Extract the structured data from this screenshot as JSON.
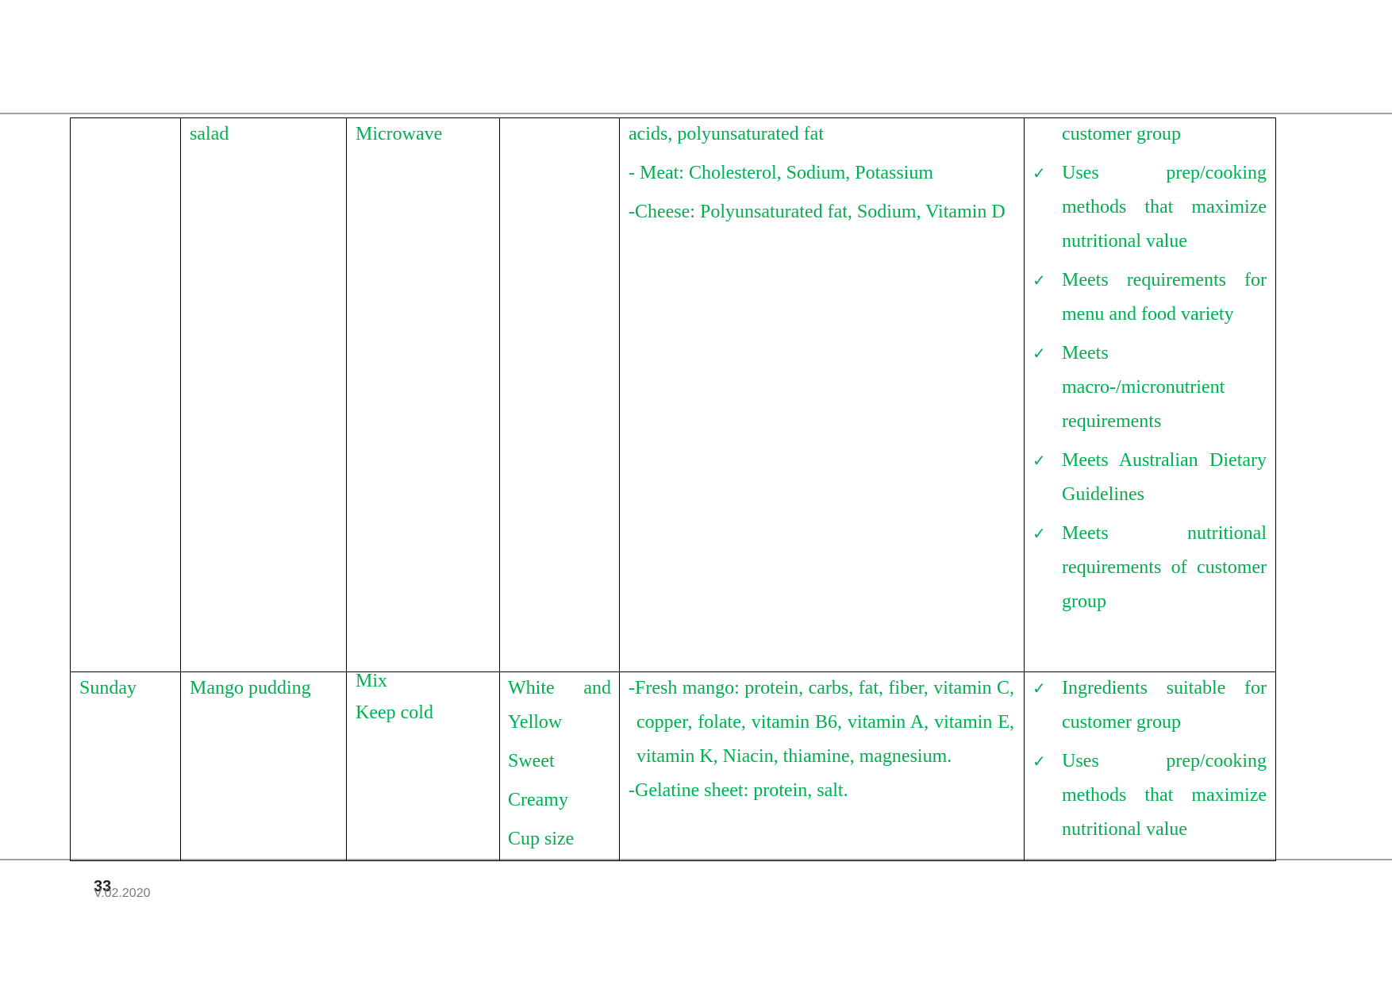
{
  "colors": {
    "text": "#00b050",
    "border": "#000000"
  },
  "table": {
    "row1": {
      "day": "",
      "dish": "salad",
      "method": "Microwave",
      "description": [],
      "nutrients": [
        "acids, polyunsaturated fat",
        "- Meat: Cholesterol, Sodium, Potassium",
        "-Cheese: Polyunsaturated fat, Sodium, Vitamin D"
      ],
      "criteria_continued": "customer group",
      "criteria": [
        "Uses prep/cooking methods that maximize nutritional value",
        "Meets requirements for menu and food variety",
        "Meets macro-/micronutrient requirements",
        "Meets Australian Dietary Guidelines",
        "Meets nutritional requirements of customer group"
      ]
    },
    "row2": {
      "day": "Sunday",
      "dish": "Mango pudding",
      "method": [
        "Mix",
        "Keep cold"
      ],
      "description": [
        "White and Yellow",
        "Sweet",
        "Creamy",
        "Cup size"
      ],
      "nutrients": [
        "-Fresh mango: protein, carbs, fat, fiber, vitamin C, copper, folate, vitamin B6, vitamin A, vitamin E, vitamin K, Niacin, thiamine, magnesium.",
        "-Gelatine sheet: protein, salt."
      ],
      "criteria": [
        "Ingredients suitable for customer group",
        "Uses prep/cooking methods that maximize nutritional value"
      ]
    }
  },
  "check_icon": "check-mark-icon",
  "footer": {
    "page_number": "33",
    "version": "V.02.2020"
  }
}
